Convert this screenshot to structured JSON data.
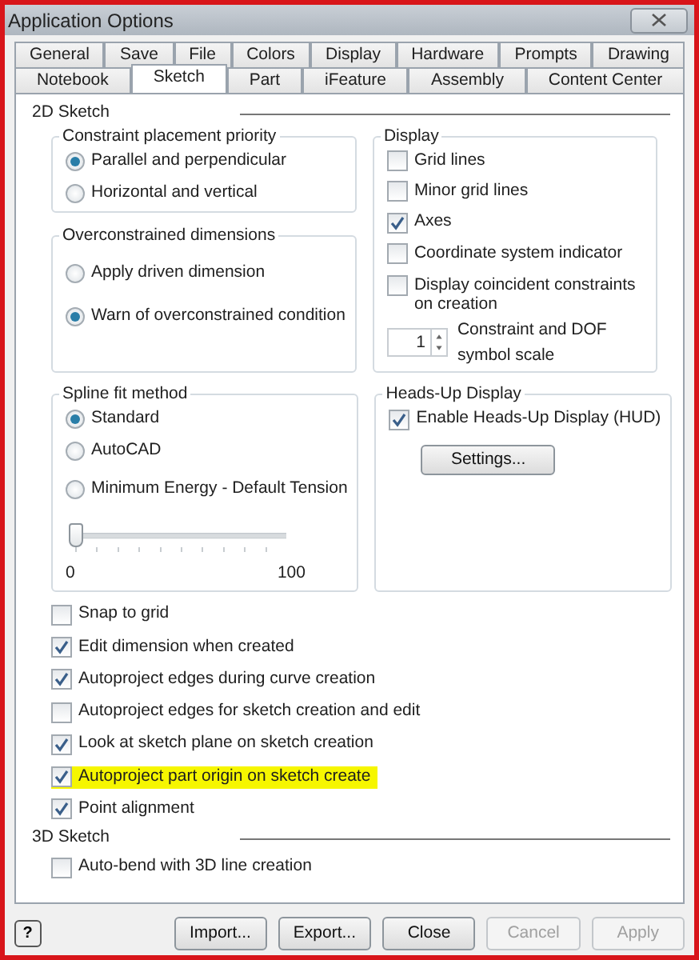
{
  "window": {
    "title": "Application Options"
  },
  "tab_rows": [
    [
      {
        "label": "General",
        "selected": false
      },
      {
        "label": "Save",
        "selected": false
      },
      {
        "label": "File",
        "selected": false
      },
      {
        "label": "Colors",
        "selected": false
      },
      {
        "label": "Display",
        "selected": false
      },
      {
        "label": "Hardware",
        "selected": false
      },
      {
        "label": "Prompts",
        "selected": false
      },
      {
        "label": "Drawing",
        "selected": false
      }
    ],
    [
      {
        "label": "Notebook",
        "selected": false
      },
      {
        "label": "Sketch",
        "selected": true
      },
      {
        "label": "Part",
        "selected": false
      },
      {
        "label": "iFeature",
        "selected": false
      },
      {
        "label": "Assembly",
        "selected": false
      },
      {
        "label": "Content Center",
        "selected": false
      }
    ]
  ],
  "sketch_2d": {
    "title": "2D Sketch",
    "constraint_placement": {
      "title": "Constraint placement priority",
      "options": [
        {
          "label": "Parallel and perpendicular",
          "selected": true
        },
        {
          "label": "Horizontal and vertical",
          "selected": false
        }
      ]
    },
    "overconstrained": {
      "title": "Overconstrained dimensions",
      "options": [
        {
          "label": "Apply driven dimension",
          "selected": false
        },
        {
          "label": "Warn of overconstrained condition",
          "selected": true
        }
      ]
    },
    "display": {
      "title": "Display",
      "options": [
        {
          "label": "Grid lines",
          "checked": false
        },
        {
          "label": "Minor grid lines",
          "checked": false
        },
        {
          "label": "Axes",
          "checked": true
        },
        {
          "label": "Coordinate system indicator",
          "checked": false
        },
        {
          "label": "Display coincident constraints on creation",
          "checked": false
        }
      ],
      "spinner": {
        "value": "1",
        "label": "Constraint and DOF symbol scale"
      }
    },
    "spline_fit": {
      "title": "Spline fit method",
      "options": [
        {
          "label": "Standard",
          "selected": true
        },
        {
          "label": "AutoCAD",
          "selected": false
        },
        {
          "label": "Minimum Energy - Default Tension",
          "selected": false
        }
      ],
      "slider": {
        "level": 0,
        "min_label": "0",
        "max_label": "100"
      }
    },
    "hud": {
      "title": "Heads-Up Display",
      "option": {
        "label": "Enable Heads-Up Display (HUD)",
        "checked": true
      },
      "button": "Settings..."
    },
    "options": [
      {
        "label": "Snap to grid",
        "checked": false,
        "highlighted": false
      },
      {
        "label": "Edit dimension when created",
        "checked": true,
        "highlighted": false
      },
      {
        "label": "Autoproject edges during curve creation",
        "checked": true,
        "highlighted": false
      },
      {
        "label": "Autoproject edges for sketch creation and edit",
        "checked": false,
        "highlighted": false
      },
      {
        "label": "Look at sketch plane on sketch creation",
        "checked": true,
        "highlighted": false
      },
      {
        "label": "Autoproject part origin on sketch create",
        "checked": true,
        "highlighted": true
      },
      {
        "label": "Point alignment",
        "checked": true,
        "highlighted": false
      }
    ]
  },
  "sketch_3d": {
    "title": "3D Sketch",
    "options": [
      {
        "label": "Auto-bend with 3D line creation",
        "checked": false
      }
    ]
  },
  "help_button": "?",
  "buttons": [
    {
      "label": "Import...",
      "disabled": false
    },
    {
      "label": "Export...",
      "disabled": false
    },
    {
      "label": "Close",
      "disabled": false
    },
    {
      "label": "Cancel",
      "disabled": true
    },
    {
      "label": "Apply",
      "disabled": true
    }
  ]
}
